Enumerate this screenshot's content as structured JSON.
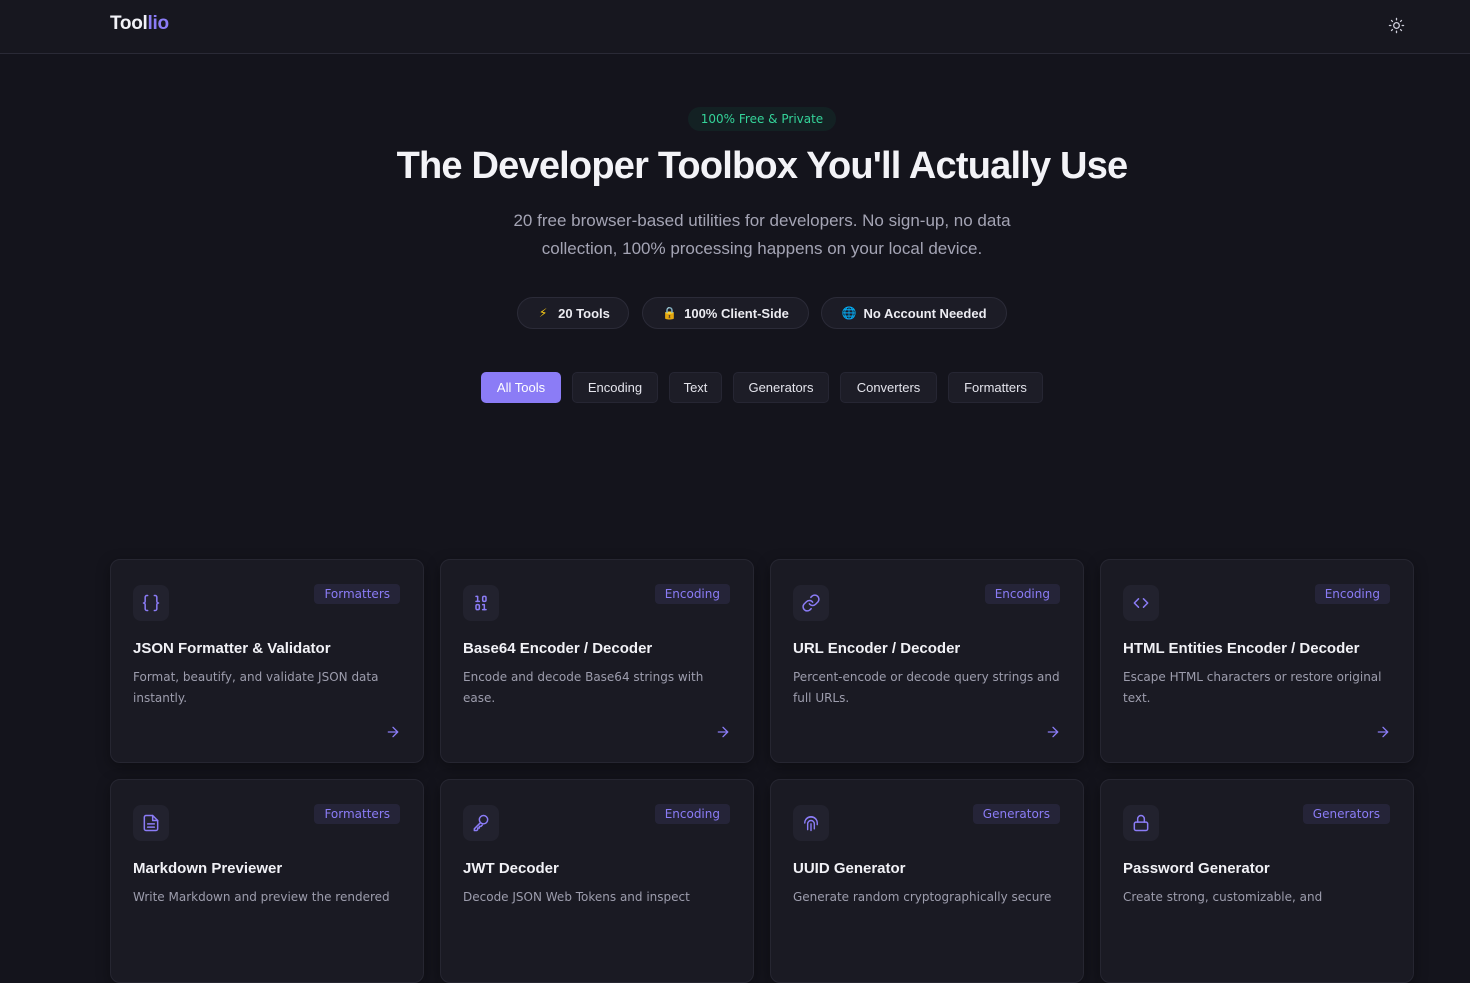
{
  "header": {
    "logo_main": "Tool",
    "logo_accent": "lio",
    "theme_icon": "sun-icon"
  },
  "hero": {
    "badge": "100% Free & Private",
    "title": "The Developer Toolbox You'll Actually Use",
    "subtitle": "20 free browser-based utilities for developers. No sign-up, no data collection, 100% processing happens on your local device."
  },
  "stats": [
    {
      "icon": "lightning-icon",
      "glyph": "⚡",
      "label": "20 Tools",
      "color": "#facc15"
    },
    {
      "icon": "lock-icon",
      "glyph": "🔒",
      "label": "100% Client-Side",
      "color": "#f59e0b"
    },
    {
      "icon": "globe-icon",
      "glyph": "🌐",
      "label": "No Account Needed",
      "color": "#38bdf8"
    }
  ],
  "filters": [
    {
      "label": "All Tools",
      "active": true
    },
    {
      "label": "Encoding",
      "active": false
    },
    {
      "label": "Text",
      "active": false
    },
    {
      "label": "Generators",
      "active": false
    },
    {
      "label": "Converters",
      "active": false
    },
    {
      "label": "Formatters",
      "active": false
    }
  ],
  "tools": [
    {
      "icon": "braces-icon",
      "tag": "Formatters",
      "title": "JSON Formatter & Validator",
      "desc": "Format, beautify, and validate JSON data instantly."
    },
    {
      "icon": "binary-icon",
      "tag": "Encoding",
      "title": "Base64 Encoder / Decoder",
      "desc": "Encode and decode Base64 strings with ease."
    },
    {
      "icon": "link-icon",
      "tag": "Encoding",
      "title": "URL Encoder / Decoder",
      "desc": "Percent-encode or decode query strings and full URLs."
    },
    {
      "icon": "code-icon",
      "tag": "Encoding",
      "title": "HTML Entities Encoder / Decoder",
      "desc": "Escape HTML characters or restore original text."
    },
    {
      "icon": "file-text-icon",
      "tag": "Formatters",
      "title": "Markdown Previewer",
      "desc": "Write Markdown and preview the rendered"
    },
    {
      "icon": "key-icon",
      "tag": "Encoding",
      "title": "JWT Decoder",
      "desc": "Decode JSON Web Tokens and inspect"
    },
    {
      "icon": "fingerprint-icon",
      "tag": "Generators",
      "title": "UUID Generator",
      "desc": "Generate random cryptographically secure"
    },
    {
      "icon": "padlock-icon",
      "tag": "Generators",
      "title": "Password Generator",
      "desc": "Create strong, customizable, and"
    }
  ],
  "colors": {
    "accent": "#8b7cf6",
    "badge_green": "#34d399",
    "background": "#14141c"
  }
}
